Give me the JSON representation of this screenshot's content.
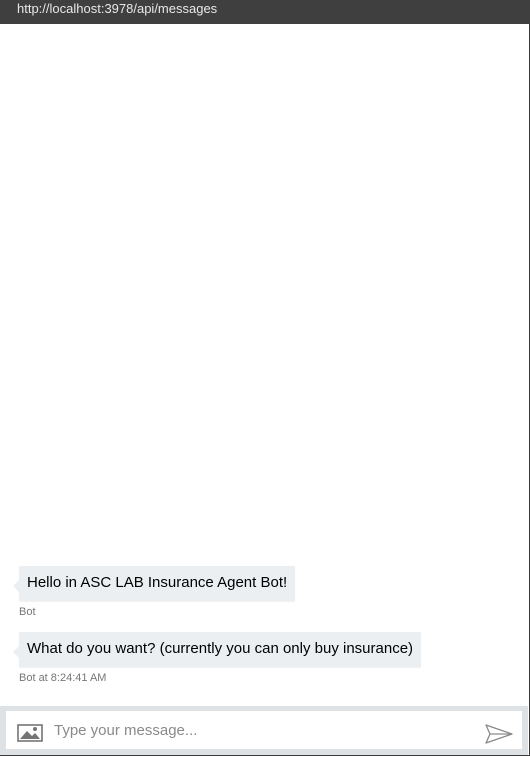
{
  "window": {
    "url": "http://localhost:3978/api/messages"
  },
  "messages": [
    {
      "text": "Hello in ASC LAB Insurance Agent Bot!",
      "meta": "Bot"
    },
    {
      "text": "What do you want? (currently you can only buy insurance)",
      "meta": "Bot at 8:24:41 AM"
    }
  ],
  "composer": {
    "placeholder": "Type your message..."
  },
  "icons": {
    "upload": "image-icon",
    "send": "send-icon"
  }
}
